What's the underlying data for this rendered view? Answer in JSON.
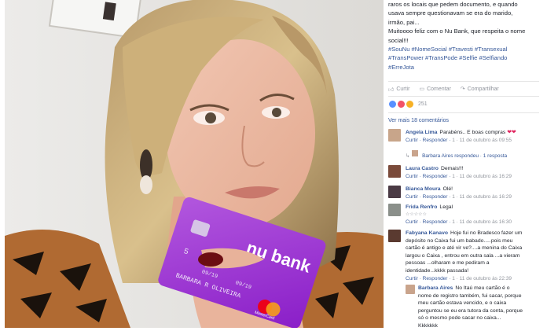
{
  "post": {
    "lines": [
      "raros os locais que pedem documento, e quando",
      "usava sempre questionavam se era do marido,",
      "irmão, pai...",
      "Muitoooo feliz com o Nu Bank, que respeita o nome",
      "social!!!"
    ],
    "hashtags": [
      "#SouNu #NomeSocial #Travesti #Transexual",
      "#TransPower #TransPode #Selfie #Selfiando",
      "#ErreJota"
    ]
  },
  "actions": {
    "like": "Curtir",
    "comment": "Comentar",
    "share": "Compartilhar"
  },
  "reactions": {
    "count": "251",
    "colors": [
      "#5890ff",
      "#f25268",
      "#f7b125"
    ]
  },
  "more_comments": "Ver mais 18 comentários",
  "card": {
    "brand": "nu bank",
    "number": "5",
    "expiry_left": "09/19",
    "expiry_right": "09/19",
    "holder": "BARBARA R OLIVEIRA",
    "network": "MasterCard",
    "color": "#8a0fc6"
  },
  "comments": [
    {
      "author": "Angela Lima",
      "text": "Parabéns.. E boas compras",
      "meta_actions": "Curtir · Responder · ",
      "meta_count": "1",
      "meta_time": "11 de outubro às 09:55",
      "reply": "Barbara Aires respondeu · 1 resposta"
    },
    {
      "author": "Laura Castro",
      "text": "Demais!!!",
      "meta_actions": "Curtir · Responder · ",
      "meta_count": "1",
      "meta_time": "11 de outubro às 16:29"
    },
    {
      "author": "Bianca Moura",
      "text": "Olé!",
      "meta_actions": "Curtir · Responder · ",
      "meta_count": "1",
      "meta_time": "11 de outubro às 16:29"
    },
    {
      "author": "Frida Renfro",
      "text": "Legal",
      "stars": "☆☆☆☆☆",
      "meta_actions": "Curtir · Responder · ",
      "meta_count": "1",
      "meta_time": "11 de outubro às 16:30"
    },
    {
      "author": "Fabyana Kanavo",
      "text_lines": [
        "Hoje fui no Bradesco fazer um",
        "depósito no Caixa fui um babado.....pois meu",
        "cartão é antigo e até vir ve?....a menina do Caixa",
        "largou o Caixa , entrou em outra sala ...a vieram",
        "pessoas ...olharam e me pediram a",
        "identidade...kkkk passada!"
      ],
      "meta_actions": "Curtir · Responder · ",
      "meta_count": "1",
      "meta_time": "11 de outubro às 22:39"
    },
    {
      "author": "Barbara Aires",
      "text_lines": [
        "No Itaú meu cartão é o",
        "nome de registro também, fui sacar, porque",
        "meu cartão estava vencido, e o caixa",
        "perguntou se eu era tutora da conta, porque",
        "só o mesmo pode sacar no caixa...",
        "Kkkkkkk"
      ]
    }
  ]
}
